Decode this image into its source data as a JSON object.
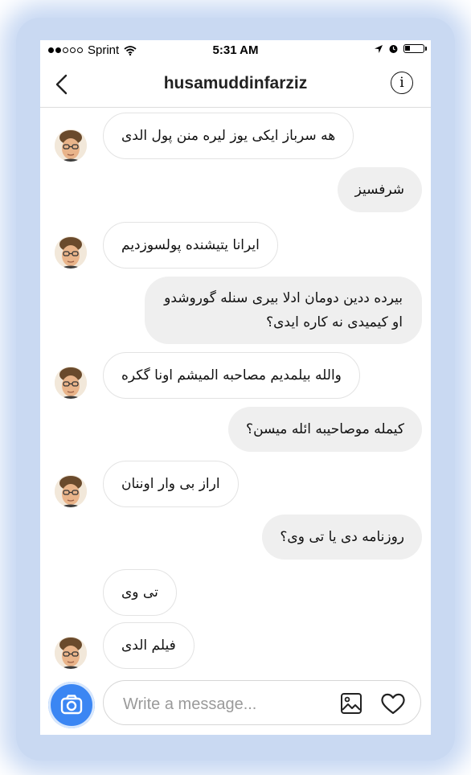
{
  "status_bar": {
    "signal_dots_filled": 2,
    "signal_dots_total": 5,
    "carrier": "Sprint",
    "time": "5:31 AM",
    "battery_level": 0.3,
    "icons": [
      "wifi-icon",
      "location-arrow-icon",
      "alarm-icon",
      "battery-icon"
    ]
  },
  "header": {
    "back_icon": "chevron-left-icon",
    "title": "husamuddinfarziz",
    "info_label": "i"
  },
  "messages": [
    {
      "side": "in",
      "avatar": true,
      "text": "هه سرباز ایکی یوز لیره منن پول الدی"
    },
    {
      "side": "out",
      "text": "شرفسیز"
    },
    {
      "side": "in",
      "avatar": true,
      "text": "ایرانا یتیشنده پولسوزدیم"
    },
    {
      "side": "out",
      "text": "بیرده ددین دومان ادلا بیری سنله گوروشدو"
    },
    {
      "side": "out",
      "text": "او کیمیدی نه کاره ایدی؟"
    },
    {
      "side": "in",
      "avatar": true,
      "text": "والله بیلمدیم مصاحبه المیشم اونا گکره"
    },
    {
      "side": "out",
      "text": "کیمله موصاحیبه ائله میسن؟"
    },
    {
      "side": "in",
      "avatar": true,
      "text": "اراز بی وار اوننان"
    },
    {
      "side": "out",
      "text": "روزنامه دی یا تی وی؟"
    },
    {
      "side": "in",
      "avatar": false,
      "text": "تی وی"
    },
    {
      "side": "in",
      "avatar": true,
      "text": "فیلم الدی"
    }
  ],
  "composer": {
    "camera_icon": "camera-icon",
    "placeholder": "Write a message...",
    "gallery_icon": "image-icon",
    "heart_icon": "heart-icon"
  },
  "colors": {
    "camera_button": "#3b86f3",
    "outgoing_bubble": "#efefef",
    "incoming_border": "#e3e3e3",
    "glow": "#c7d8f3"
  }
}
